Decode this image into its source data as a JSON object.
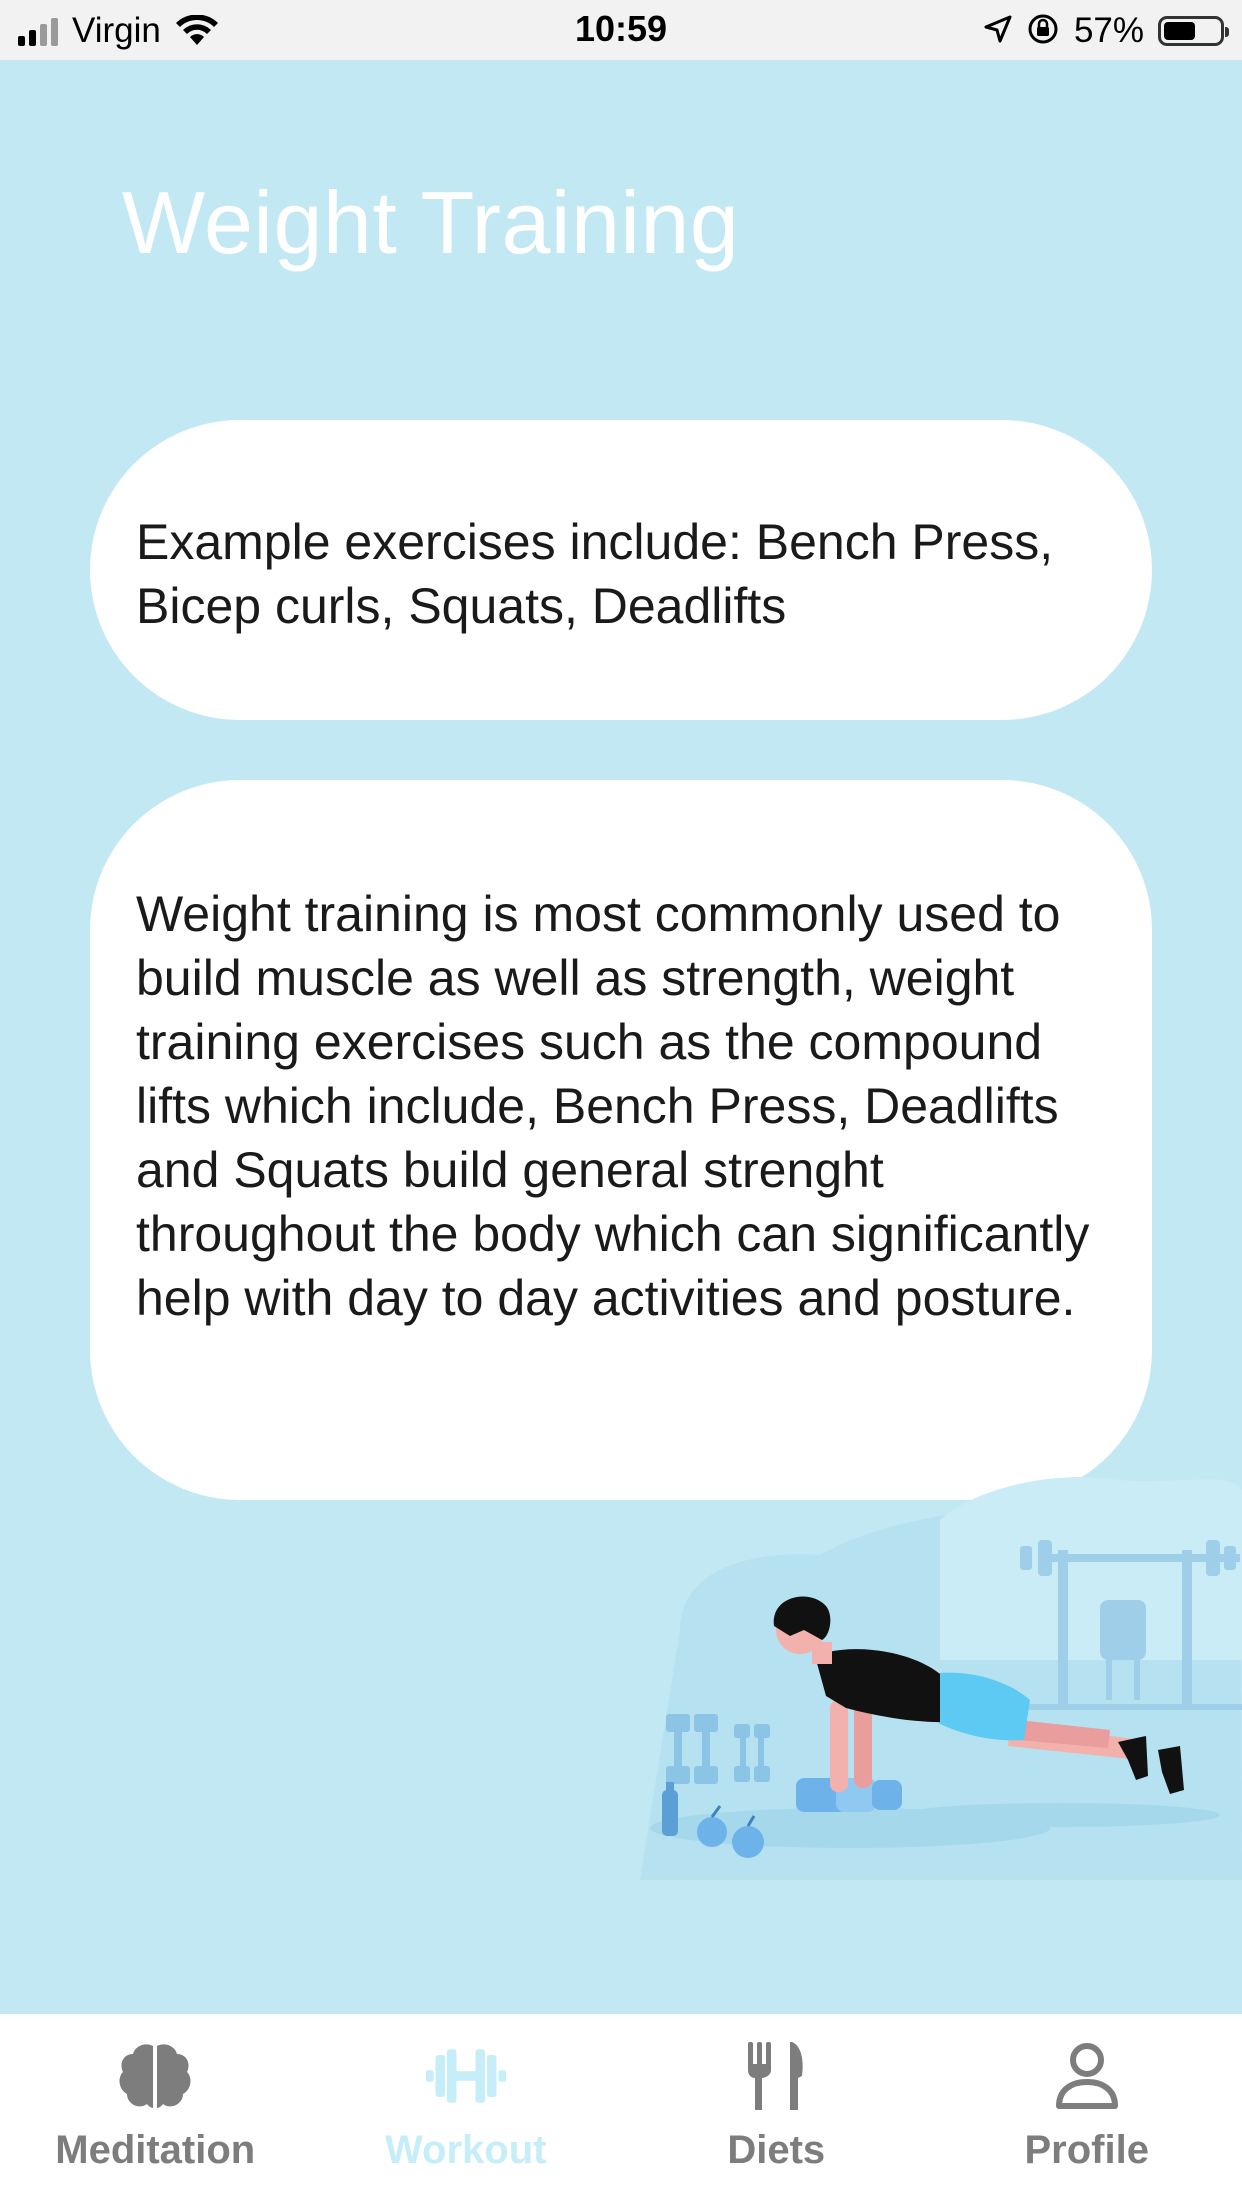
{
  "status_bar": {
    "carrier": "Virgin",
    "time": "10:59",
    "battery_percent": "57%",
    "battery_level": 0.57
  },
  "header": {
    "title": "Weight Training"
  },
  "cards": [
    {
      "text": "Example exercises include: Bench Press, Bicep curls, Squats, Deadlifts"
    },
    {
      "text": "Weight training is most commonly used to build muscle as well as strength, weight training exercises such as the compound lifts which include, Bench Press, Deadlifts and Squats build general strenght throughout the body which can significantly help with day to day activities and posture."
    }
  ],
  "tabs": [
    {
      "label": "Meditation",
      "icon": "brain-icon",
      "active": false
    },
    {
      "label": "Workout",
      "icon": "dumbbell-icon",
      "active": true
    },
    {
      "label": "Diets",
      "icon": "fork-knife-icon",
      "active": false
    },
    {
      "label": "Profile",
      "icon": "person-icon",
      "active": false
    }
  ],
  "colors": {
    "background": "#c1e8f3",
    "card": "#ffffff",
    "tab_active": "#c5eef9",
    "tab_inactive": "#7d7d7d"
  }
}
